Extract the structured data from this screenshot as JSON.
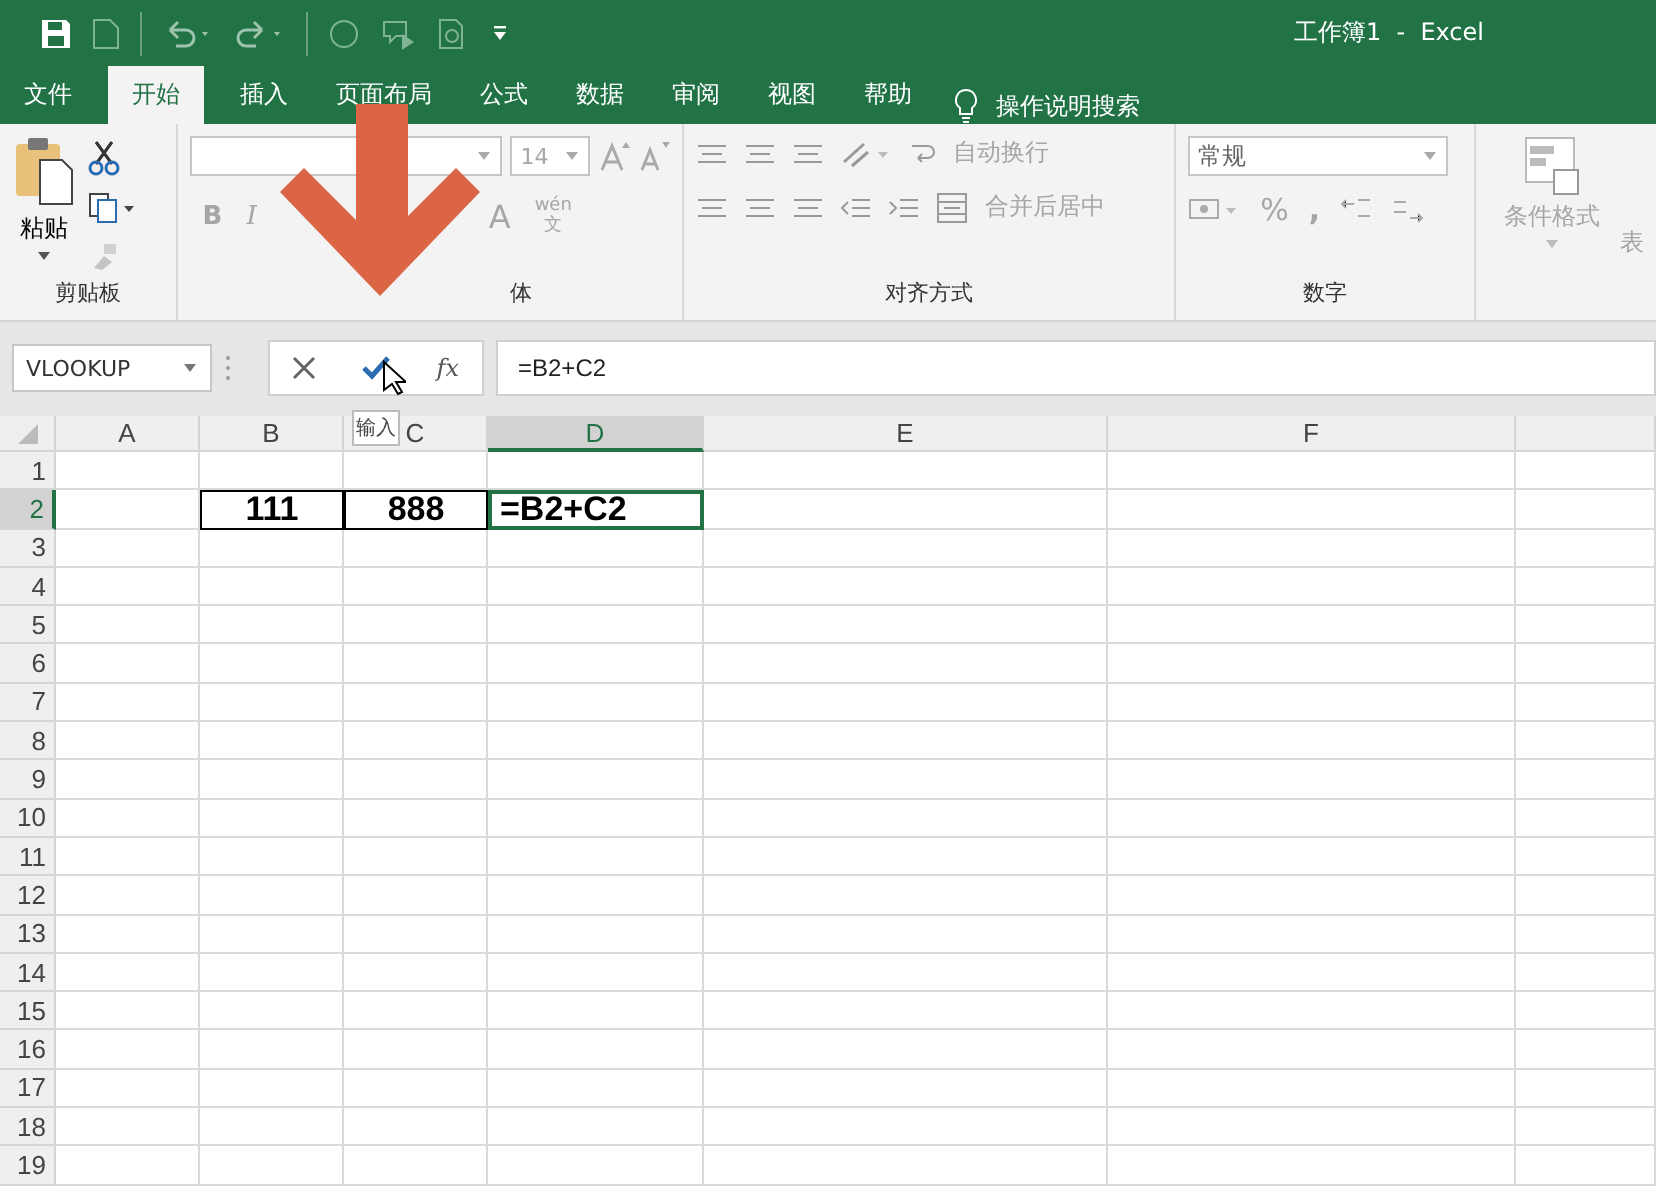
{
  "window": {
    "title": "工作簿1  -  Excel"
  },
  "tabs": [
    {
      "label": "文件",
      "selected": false
    },
    {
      "label": "开始",
      "selected": true
    },
    {
      "label": "插入",
      "selected": false
    },
    {
      "label": "页面布局",
      "selected": false
    },
    {
      "label": "公式",
      "selected": false
    },
    {
      "label": "数据",
      "selected": false
    },
    {
      "label": "审阅",
      "selected": false
    },
    {
      "label": "视图",
      "selected": false
    },
    {
      "label": "帮助",
      "selected": false
    }
  ],
  "tell_me": {
    "placeholder": "操作说明搜索"
  },
  "ribbon": {
    "clipboard": {
      "paste": "粘贴",
      "label": "剪贴板"
    },
    "font": {
      "size": "14",
      "bold": "B",
      "italic": "I",
      "font_color": "A",
      "phonetic_top": "wén",
      "phonetic_bottom": "文",
      "label": "体"
    },
    "alignment": {
      "wrap": "自动换行",
      "merge": "合并后居中",
      "label": "对齐方式"
    },
    "number": {
      "format": "常规",
      "percent": "%",
      "comma": ",",
      "label": "数字"
    },
    "styles": {
      "conditional": "条件格式",
      "table_cut": "表"
    }
  },
  "formula_bar": {
    "name_box": "VLOOKUP",
    "function_button": "fx",
    "formula": "=B2+C2",
    "tooltip": "输入"
  },
  "grid": {
    "columns": [
      {
        "label": "A",
        "selected": false
      },
      {
        "label": "B",
        "selected": false
      },
      {
        "label": "C",
        "selected": false
      },
      {
        "label": "D",
        "selected": true
      },
      {
        "label": "E",
        "selected": false
      },
      {
        "label": "F",
        "selected": false
      }
    ],
    "rows": [
      {
        "label": "1",
        "selected": false
      },
      {
        "label": "2",
        "selected": true,
        "cells": [
          null,
          {
            "text": "111",
            "bordered": true,
            "active": false
          },
          {
            "text": "888",
            "bordered": true,
            "active": false
          },
          {
            "text": "=B2+C2",
            "bordered": false,
            "active": true
          }
        ]
      },
      {
        "label": "3",
        "selected": false
      },
      {
        "label": "4",
        "selected": false
      },
      {
        "label": "5",
        "selected": false
      },
      {
        "label": "6",
        "selected": false
      },
      {
        "label": "7",
        "selected": false
      },
      {
        "label": "8",
        "selected": false
      },
      {
        "label": "9",
        "selected": false
      },
      {
        "label": "10",
        "selected": false
      },
      {
        "label": "11",
        "selected": false
      },
      {
        "label": "12",
        "selected": false
      },
      {
        "label": "13",
        "selected": false
      },
      {
        "label": "14",
        "selected": false
      },
      {
        "label": "15",
        "selected": false
      },
      {
        "label": "16",
        "selected": false
      },
      {
        "label": "17",
        "selected": false
      },
      {
        "label": "18",
        "selected": false
      },
      {
        "label": "19",
        "selected": false
      }
    ]
  }
}
